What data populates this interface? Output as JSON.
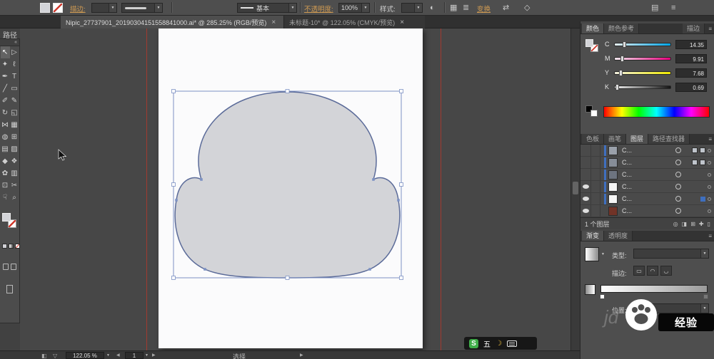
{
  "control_bar": {
    "object_type": "路径",
    "stroke_link": "描边:",
    "brush_value": "基本",
    "opacity_link": "不透明度:",
    "opacity_value": "100%",
    "style_label": "样式:",
    "transform_link": "变换",
    "icons": {
      "recolor": "◐",
      "align_grid": "▦",
      "stack": "≣",
      "swap": "⇄",
      "constrain": "◇",
      "dock_a": "▤",
      "dock_b": "≡"
    }
  },
  "ui_icons": {
    "caret": "▼",
    "panel_menu": "≡",
    "collapse": "«"
  },
  "tab_bar": {
    "tabs": [
      {
        "title": "Nipic_27737901_20190304151558841000.ai* @ 285.25% (RGB/预览)",
        "close": "×"
      },
      {
        "title": "未标题-10* @ 122.05% (CMYK/预览)",
        "close": "×"
      }
    ]
  },
  "tools": {
    "rows": [
      [
        {
          "name": "selection",
          "glyph": "↖",
          "active": true
        },
        {
          "name": "direct-selection",
          "glyph": "▷"
        }
      ],
      [
        {
          "name": "magic-wand",
          "glyph": "✦"
        },
        {
          "name": "lasso",
          "glyph": "ℓ"
        }
      ],
      [
        {
          "name": "pen",
          "glyph": "✒"
        },
        {
          "name": "type",
          "glyph": "T"
        }
      ],
      [
        {
          "name": "line-segment",
          "glyph": "╱"
        },
        {
          "name": "rectangle",
          "glyph": "▭"
        }
      ],
      [
        {
          "name": "paintbrush",
          "glyph": "✐"
        },
        {
          "name": "pencil",
          "glyph": "✎"
        }
      ],
      [
        {
          "name": "rotate",
          "glyph": "↻"
        },
        {
          "name": "scale",
          "glyph": "◱"
        }
      ],
      [
        {
          "name": "width",
          "glyph": "⋈"
        },
        {
          "name": "free-transform",
          "glyph": "▦"
        }
      ],
      [
        {
          "name": "shape-builder",
          "glyph": "◍"
        },
        {
          "name": "perspective-grid",
          "glyph": "⊞"
        }
      ],
      [
        {
          "name": "mesh",
          "glyph": "▤"
        },
        {
          "name": "gradient",
          "glyph": "▨"
        }
      ],
      [
        {
          "name": "eyedropper",
          "glyph": "◆"
        },
        {
          "name": "blend",
          "glyph": "❖"
        }
      ],
      [
        {
          "name": "symbol-sprayer",
          "glyph": "✿"
        },
        {
          "name": "column-graph",
          "glyph": "▥"
        }
      ],
      [
        {
          "name": "artboard",
          "glyph": "⊡"
        },
        {
          "name": "slice",
          "glyph": "✂"
        }
      ],
      [
        {
          "name": "hand",
          "glyph": "☟"
        },
        {
          "name": "zoom",
          "glyph": "⌕"
        }
      ]
    ]
  },
  "canvas": {
    "shape_fill": "#d3d4d8",
    "shape_stroke": "#5b6b99",
    "selection_color": "#7d92c4",
    "guide_color": "#a03a30"
  },
  "ui_colors": {
    "accent_blue": "#3f6fbf",
    "link_orange": "#cf9a52"
  },
  "color_panel": {
    "tabs": [
      {
        "name": "color",
        "label": "颜色",
        "active": true
      },
      {
        "name": "color-guide",
        "label": "颜色参考"
      },
      {
        "name": "stroke",
        "label": "描边",
        "right": true
      }
    ],
    "sliders": [
      {
        "channel": "C",
        "value": "14.35"
      },
      {
        "channel": "M",
        "value": "9.91"
      },
      {
        "channel": "Y",
        "value": "7.68"
      },
      {
        "channel": "K",
        "value": "0.69"
      }
    ]
  },
  "layers_panel": {
    "tabs": [
      {
        "name": "swatches",
        "label": "色板"
      },
      {
        "name": "brushes",
        "label": "画笔"
      },
      {
        "name": "layers",
        "label": "图层",
        "active": true
      },
      {
        "name": "pathfinder",
        "label": "路径查找器"
      }
    ],
    "rows": [
      {
        "label": "C...",
        "thumb": "#9aa0aa",
        "eye": false,
        "accent": true,
        "extras": true,
        "selected": false
      },
      {
        "label": "C...",
        "thumb": "#868d98",
        "eye": false,
        "accent": true,
        "extras": true,
        "selected": false
      },
      {
        "label": "C...",
        "thumb": "#6d7480",
        "eye": false,
        "accent": true,
        "extras": false,
        "selected": false
      },
      {
        "label": "C...",
        "thumb": "#f5f5f5",
        "eye": true,
        "accent": true,
        "extras": false,
        "selected": false
      },
      {
        "label": "C...",
        "thumb": "#f5f5f5",
        "eye": true,
        "accent": true,
        "extras": false,
        "selected": true
      },
      {
        "label": "C...",
        "thumb": "#713327",
        "eye": true,
        "accent": false,
        "extras": false,
        "selected": false
      }
    ],
    "footer_label": "1 个图层",
    "footer_icons": [
      {
        "name": "locate",
        "glyph": "◎"
      },
      {
        "name": "clip-mask",
        "glyph": "◨"
      },
      {
        "name": "new-sublayer",
        "glyph": "⊞"
      },
      {
        "name": "new-layer",
        "glyph": "✚"
      },
      {
        "name": "delete-layer",
        "glyph": "▯"
      }
    ]
  },
  "gradient_panel": {
    "tabs": [
      {
        "name": "gradient",
        "label": "渐变",
        "active": true
      },
      {
        "name": "transparency",
        "label": "透明度"
      }
    ],
    "type_label": "类型:",
    "stroke_label": "描边:",
    "stroke_icons": [
      {
        "name": "gradient-within-stroke",
        "glyph": "▭"
      },
      {
        "name": "gradient-along-stroke",
        "glyph": "◠"
      },
      {
        "name": "gradient-across-stroke",
        "glyph": "◡"
      }
    ],
    "position_label": "位置:"
  },
  "status_bar": {
    "zoom_value": "122.05 %",
    "artboard_value": "1",
    "status_text": "选择",
    "icons": {
      "left_a": "◧",
      "left_b": "▽",
      "prev": "◀",
      "next": "▶",
      "play": "▶"
    }
  },
  "ime": {
    "sogou_badge": "S",
    "mode": "五",
    "moon": "☽"
  },
  "watermark": {
    "ghost": "jd",
    "label": "经验"
  }
}
